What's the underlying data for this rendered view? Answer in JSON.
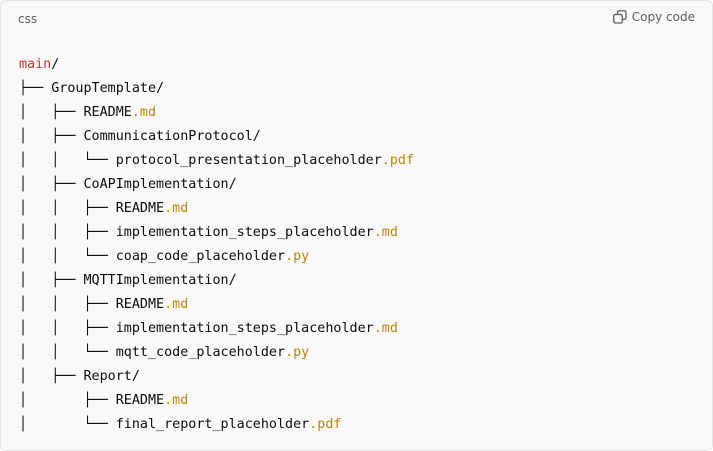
{
  "code_block": {
    "language": "css",
    "copy_label": "Copy code",
    "icons": {
      "copy": "copy-icon"
    },
    "colors": {
      "root": "#c0392b",
      "extension": "#b8860b",
      "text": "#0d0d0d"
    },
    "lines": [
      {
        "prefix": "",
        "root": "main",
        "name": "/",
        "ext": ""
      },
      {
        "prefix": "├── ",
        "root": "",
        "name": "GroupTemplate/",
        "ext": ""
      },
      {
        "prefix": "│   ├── ",
        "root": "",
        "name": "README",
        "ext": ".md"
      },
      {
        "prefix": "│   ├── ",
        "root": "",
        "name": "CommunicationProtocol/",
        "ext": ""
      },
      {
        "prefix": "│   │   └── ",
        "root": "",
        "name": "protocol_presentation_placeholder",
        "ext": ".pdf"
      },
      {
        "prefix": "│   ├── ",
        "root": "",
        "name": "CoAPImplementation/",
        "ext": ""
      },
      {
        "prefix": "│   │   ├── ",
        "root": "",
        "name": "README",
        "ext": ".md"
      },
      {
        "prefix": "│   │   ├── ",
        "root": "",
        "name": "implementation_steps_placeholder",
        "ext": ".md"
      },
      {
        "prefix": "│   │   └── ",
        "root": "",
        "name": "coap_code_placeholder",
        "ext": ".py"
      },
      {
        "prefix": "│   ├── ",
        "root": "",
        "name": "MQTTImplementation/",
        "ext": ""
      },
      {
        "prefix": "│   │   ├── ",
        "root": "",
        "name": "README",
        "ext": ".md"
      },
      {
        "prefix": "│   │   ├── ",
        "root": "",
        "name": "implementation_steps_placeholder",
        "ext": ".md"
      },
      {
        "prefix": "│   │   └── ",
        "root": "",
        "name": "mqtt_code_placeholder",
        "ext": ".py"
      },
      {
        "prefix": "│   ├── ",
        "root": "",
        "name": "Report/",
        "ext": ""
      },
      {
        "prefix": "│       ├── ",
        "root": "",
        "name": "README",
        "ext": ".md"
      },
      {
        "prefix": "│       └── ",
        "root": "",
        "name": "final_report_placeholder",
        "ext": ".pdf"
      }
    ]
  }
}
